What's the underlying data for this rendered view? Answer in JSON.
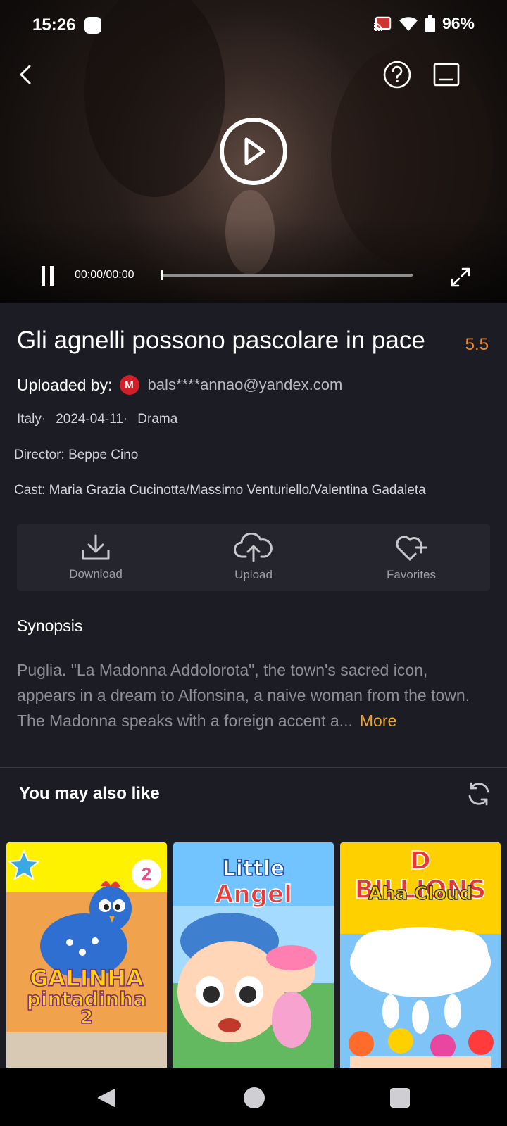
{
  "status_bar": {
    "time": "15:26",
    "battery": "96%"
  },
  "player": {
    "time_display": "00:00/00:00",
    "progress": 0
  },
  "movie": {
    "title": "Gli agnelli possono pascolare in pace",
    "rating": "5.5",
    "uploaded_by_label": "Uploaded by:",
    "uploader_badge": "M",
    "uploader_email": "bals****annao@yandex.com",
    "country": "Italy·",
    "date": "2024-04-11·",
    "genre": "Drama",
    "director": "Director: Beppe Cino",
    "cast": "Cast: Maria Grazia Cucinotta/Massimo Venturiello/Valentina Gadaleta"
  },
  "actions": {
    "download": "Download",
    "upload": "Upload",
    "favorites": "Favorites"
  },
  "synopsis": {
    "heading": "Synopsis",
    "text": "Puglia. \"La Madonna Addolorota\", the town's sacred icon, appears in a dream to Alfonsina, a naive woman from the town. The Madonna speaks with a foreign accent a...",
    "more": "More"
  },
  "recommendations": {
    "heading": "You may also like",
    "items": [
      {
        "title_line1": "GALINHA",
        "title_line2": "pintadinha",
        "title_line3": "2",
        "badge": "2"
      },
      {
        "title_line1": "Little",
        "title_line2": "Angel"
      },
      {
        "title_line1": "D BILLIONS",
        "title_line2": "Aha Cloud"
      }
    ]
  },
  "colors": {
    "background": "#1c1c24",
    "accent_orange": "#f2a527",
    "rating_orange": "#f0892e"
  }
}
